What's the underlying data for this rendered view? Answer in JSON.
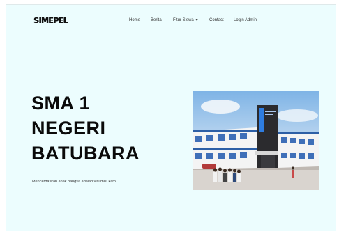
{
  "navbar": {
    "brand": "SIMEPEL",
    "links": {
      "home": "Home",
      "berita": "Berita",
      "fitur": "Fitur Siswa",
      "contact": "Contact",
      "login": "Login Admin"
    },
    "fitur_caret": "▼"
  },
  "hero": {
    "title_lines": [
      "SMA 1",
      "NEGERI",
      "BATUBARA"
    ],
    "tagline": "Mencerdaskan anak bangsa adalah visi misi kami",
    "image_icon": "school-building-photo"
  }
}
